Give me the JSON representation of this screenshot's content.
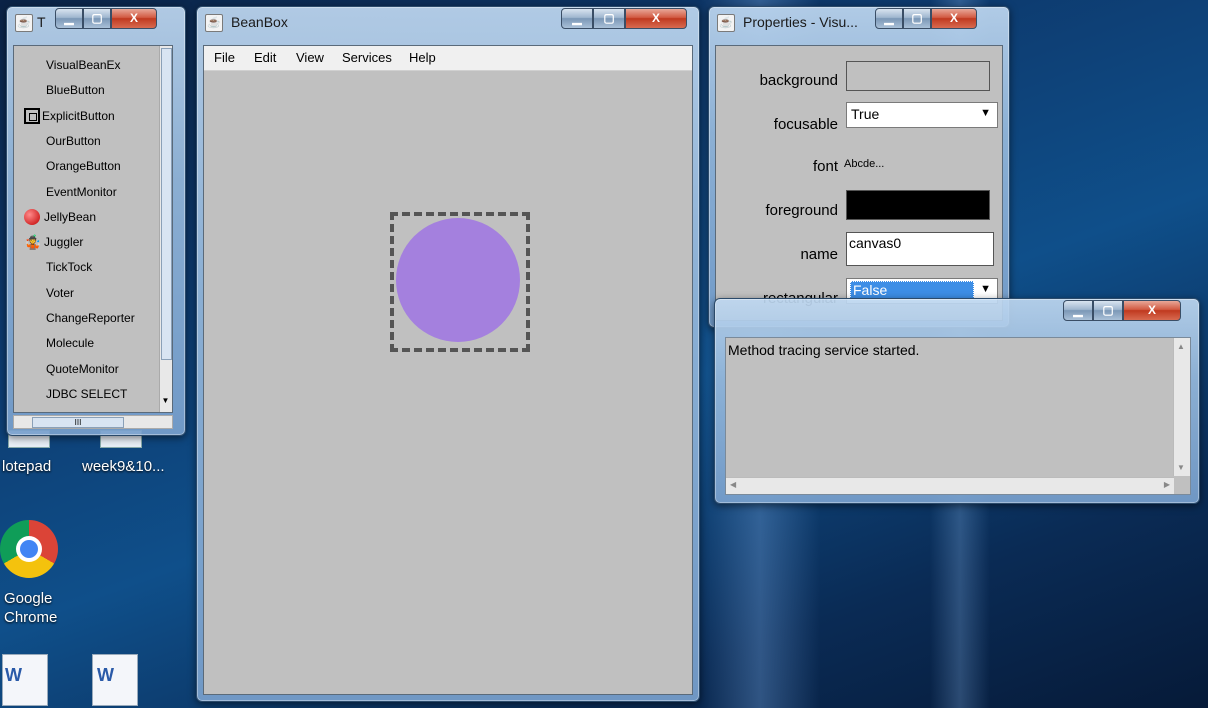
{
  "toolbox": {
    "title": "T",
    "items": [
      {
        "label": "VisualBeanEx",
        "icon": "none"
      },
      {
        "label": "BlueButton",
        "icon": "none"
      },
      {
        "label": "ExplicitButton",
        "icon": "button-icon"
      },
      {
        "label": "OurButton",
        "icon": "none"
      },
      {
        "label": "OrangeButton",
        "icon": "none"
      },
      {
        "label": "EventMonitor",
        "icon": "none"
      },
      {
        "label": "JellyBean",
        "icon": "jellybean-icon"
      },
      {
        "label": "Juggler",
        "icon": "juggler-icon"
      },
      {
        "label": "TickTock",
        "icon": "none"
      },
      {
        "label": "Voter",
        "icon": "none"
      },
      {
        "label": "ChangeReporter",
        "icon": "none"
      },
      {
        "label": "Molecule",
        "icon": "none"
      },
      {
        "label": "QuoteMonitor",
        "icon": "none"
      },
      {
        "label": "JDBC SELECT",
        "icon": "none"
      }
    ],
    "hscroll_grip": "III"
  },
  "beanbox": {
    "title": "BeanBox",
    "menu": [
      "File",
      "Edit",
      "View",
      "Services",
      "Help"
    ],
    "bean_color": "#a480de"
  },
  "properties": {
    "title": "Properties - Visu...",
    "rows": {
      "background_label": "background",
      "background_color": "#c0c0c0",
      "focusable_label": "focusable",
      "focusable_value": "True",
      "font_label": "font",
      "font_value": "Abcde...",
      "foreground_label": "foreground",
      "foreground_color": "#000000",
      "name_label": "name",
      "name_value": "canvas0",
      "rectangular_label": "rectangular",
      "rectangular_value": "False"
    }
  },
  "method_tracer": {
    "text": "Method tracing service started."
  },
  "desktop": {
    "icons": [
      "Notepad",
      "week9&10...",
      "Google\nChrome",
      "",
      ""
    ],
    "notepad": "lotepad",
    "week": "week9&10...",
    "chrome_1": "Google",
    "chrome_2": "Chrome"
  },
  "caption": {
    "min": "▁",
    "max": "▢",
    "close": "X"
  }
}
